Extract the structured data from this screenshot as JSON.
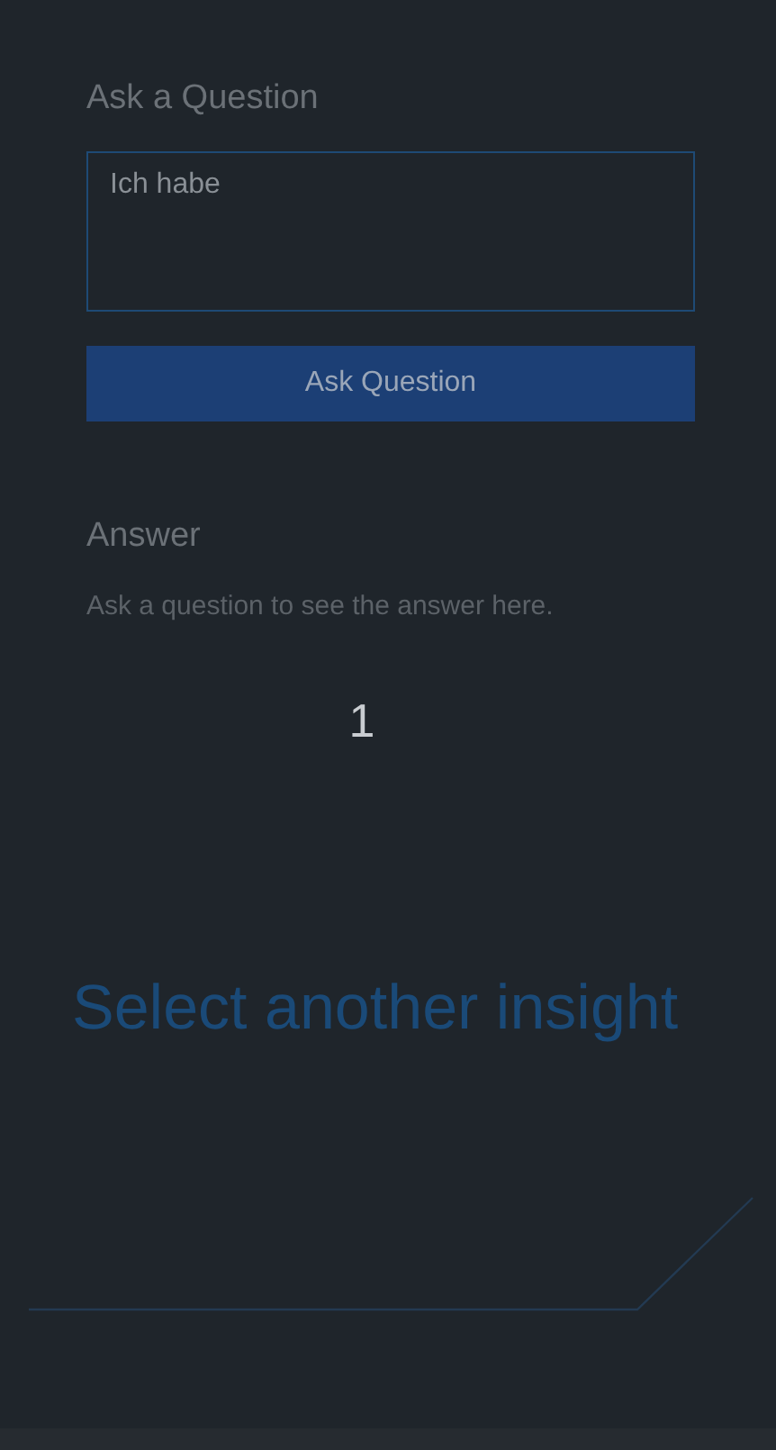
{
  "question": {
    "heading": "Ask a Question",
    "value": "Ich habe",
    "button": "Ask Question"
  },
  "answer": {
    "heading": "Answer",
    "text": "Ask a question to see the answer here."
  },
  "counter": "1",
  "insight_link": "Select another insight"
}
